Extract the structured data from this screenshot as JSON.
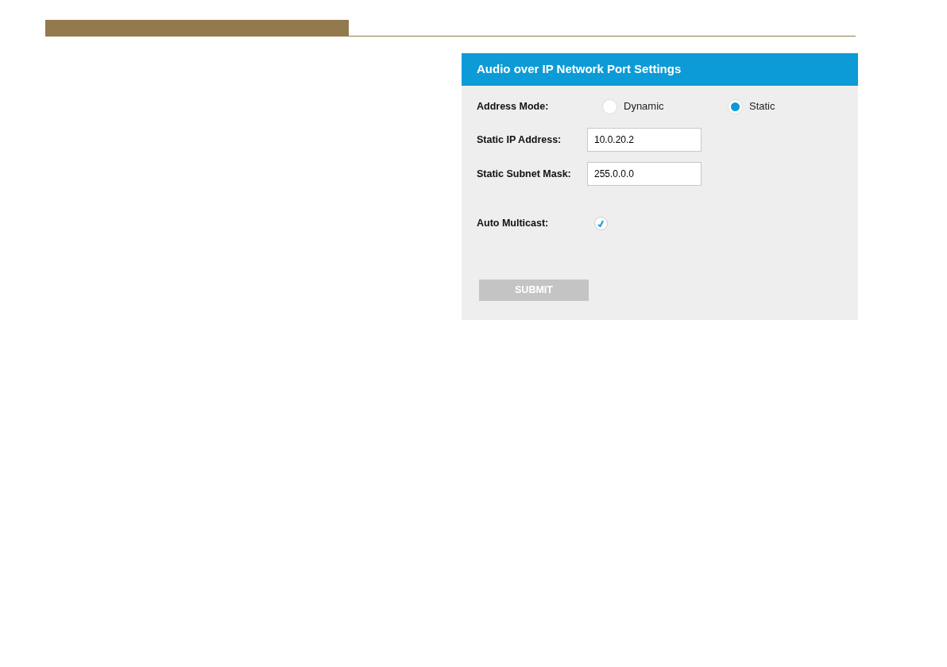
{
  "panel": {
    "title": "Audio over IP Network Port Settings",
    "address_mode": {
      "label": "Address Mode:",
      "options": [
        {
          "label": "Dynamic",
          "selected": false
        },
        {
          "label": "Static",
          "selected": true
        }
      ]
    },
    "fields": [
      {
        "label": "Static IP Address:",
        "value": "10.0.20.2"
      },
      {
        "label": "Static Subnet Mask:",
        "value": "255.0.0.0"
      }
    ],
    "auto_multicast": {
      "label": "Auto Multicast:",
      "checked": true
    },
    "submit": {
      "label": "SUBMIT",
      "disabled": true
    }
  }
}
